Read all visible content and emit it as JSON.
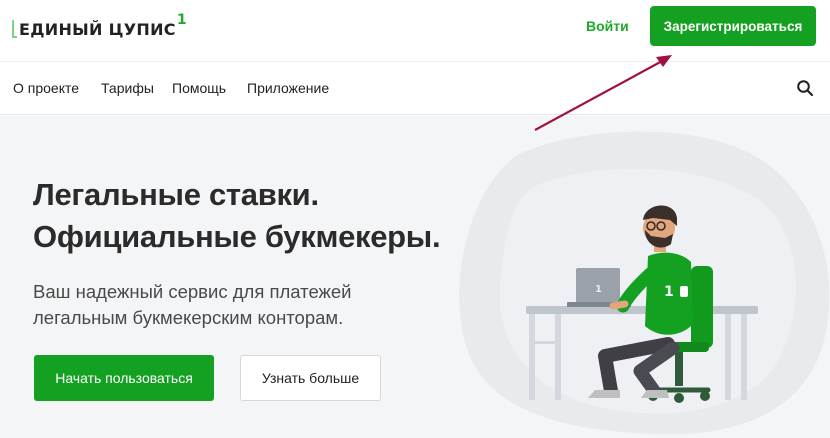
{
  "header": {
    "logo_text": "ЕДИНЫЙ ЦУПИС",
    "logo_mark": "1",
    "login_label": "Войти",
    "register_label": "Зарегистрироваться"
  },
  "nav": {
    "items": [
      {
        "label": "О проекте"
      },
      {
        "label": "Тарифы"
      },
      {
        "label": "Помощь"
      },
      {
        "label": "Приложение"
      }
    ],
    "search_icon": "search-icon"
  },
  "hero": {
    "title_line1": "Легальные ставки.",
    "title_line2": "Официальные букмекеры.",
    "subtitle_line1": "Ваш надежный сервис для платежей",
    "subtitle_line2": "легальным букмекерским конторам.",
    "primary_button": "Начать пользоваться",
    "secondary_button": "Узнать больше",
    "laptop_mark": "1",
    "shirt_number": "1"
  },
  "colors": {
    "brand_green": "#14a121",
    "annotation_arrow": "#a01040",
    "hero_bg": "#f4f5f7"
  }
}
